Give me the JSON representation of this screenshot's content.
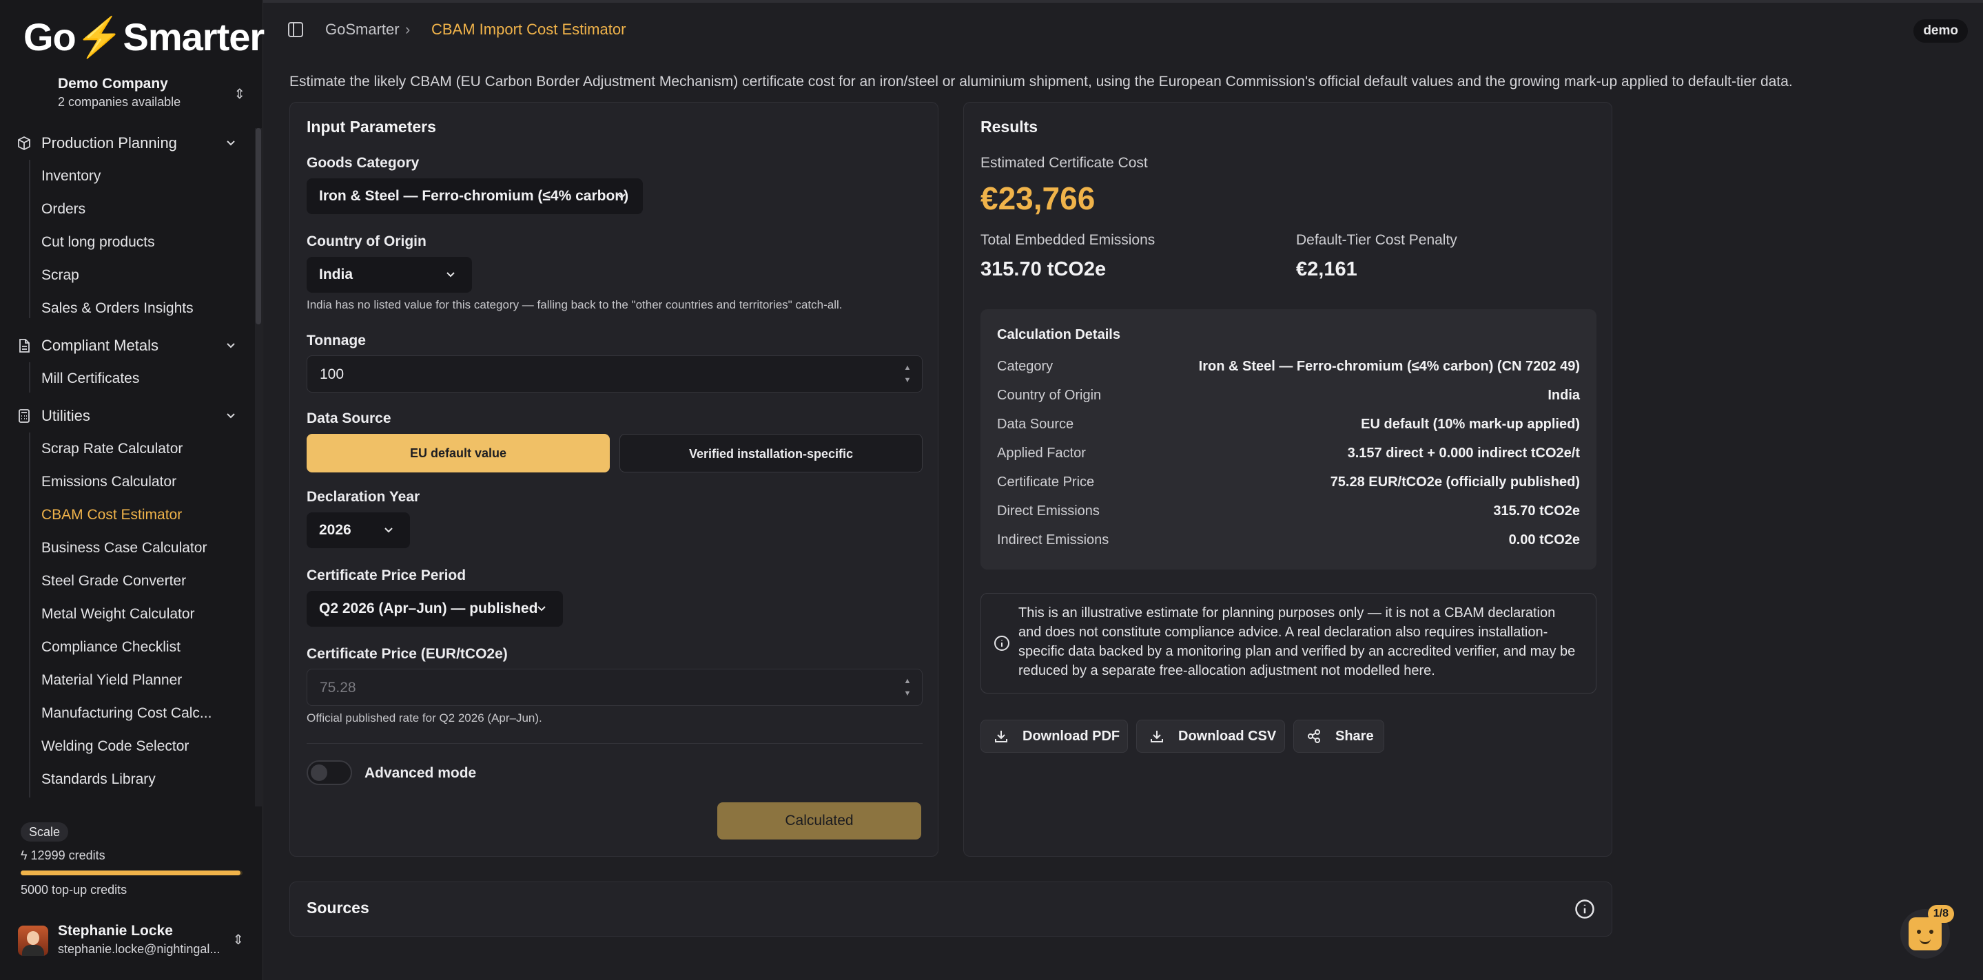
{
  "app": {
    "logo_text_1": "Go",
    "logo_bolt": "⚡",
    "logo_text_2": "Smarter"
  },
  "company": {
    "name": "Demo Company",
    "subtitle": "2 companies available"
  },
  "sidebar": {
    "groups": [
      {
        "label": "Production Planning",
        "icon": "cube-icon",
        "items": [
          "Inventory",
          "Orders",
          "Cut long products",
          "Scrap",
          "Sales & Orders Insights"
        ]
      },
      {
        "label": "Compliant Metals",
        "icon": "document-icon",
        "items": [
          "Mill Certificates"
        ]
      },
      {
        "label": "Utilities",
        "icon": "calculator-icon",
        "items": [
          "Scrap Rate Calculator",
          "Emissions Calculator",
          "CBAM Cost Estimator",
          "Business Case Calculator",
          "Steel Grade Converter",
          "Metal Weight Calculator",
          "Compliance Checklist",
          "Material Yield Planner",
          "Manufacturing Cost Calc...",
          "Welding Code Selector",
          "Standards Library"
        ]
      }
    ],
    "active_item": "CBAM Cost Estimator",
    "plan": "Scale",
    "credits": "12999 credits",
    "credits_fraction": 0.99,
    "topup": "5000 top-up credits",
    "user": {
      "name": "Stephanie Locke",
      "email": "stephanie.locke@nightingal..."
    }
  },
  "header": {
    "breadcrumb_root": "GoSmarter",
    "breadcrumb_current": "CBAM Import Cost Estimator",
    "badge": "demo"
  },
  "intro": "Estimate the likely CBAM (EU Carbon Border Adjustment Mechanism) certificate cost for an iron/steel or aluminium shipment, using the European Commission's official default values and the growing mark-up applied to default-tier data.",
  "inputs": {
    "title": "Input Parameters",
    "goods_category_label": "Goods Category",
    "goods_category_value": "Iron & Steel — Ferro-chromium (≤4% carbon)",
    "country_label": "Country of Origin",
    "country_value": "India",
    "country_hint": "India has no listed value for this category — falling back to the \"other countries and territories\" catch-all.",
    "tonnage_label": "Tonnage",
    "tonnage_value": "100",
    "data_source_label": "Data Source",
    "data_source_options": [
      "EU default value",
      "Verified installation-specific"
    ],
    "data_source_selected": "EU default value",
    "year_label": "Declaration Year",
    "year_value": "2026",
    "price_period_label": "Certificate Price Period",
    "price_period_value": "Q2 2026 (Apr–Jun) — published",
    "price_label": "Certificate Price (EUR/tCO2e)",
    "price_placeholder": "75.28",
    "price_hint": "Official published rate for Q2 2026 (Apr–Jun).",
    "advanced_label": "Advanced mode",
    "advanced_on": false,
    "calc_button": "Calculated"
  },
  "results": {
    "title": "Results",
    "estimated_label": "Estimated Certificate Cost",
    "estimated_value": "€23,766",
    "emissions_label": "Total Embedded Emissions",
    "emissions_value": "315.70 tCO2e",
    "penalty_label": "Default-Tier Cost Penalty",
    "penalty_value": "€2,161",
    "details_title": "Calculation Details",
    "details": [
      {
        "k": "Category",
        "v": "Iron & Steel — Ferro-chromium (≤4% carbon) (CN 7202 49)"
      },
      {
        "k": "Country of Origin",
        "v": "India"
      },
      {
        "k": "Data Source",
        "v": "EU default (10% mark-up applied)"
      },
      {
        "k": "Applied Factor",
        "v": "3.157 direct + 0.000 indirect tCO2e/t"
      },
      {
        "k": "Certificate Price",
        "v": "75.28 EUR/tCO2e (officially published)"
      },
      {
        "k": "Direct Emissions",
        "v": "315.70 tCO2e"
      },
      {
        "k": "Indirect Emissions",
        "v": "0.00 tCO2e"
      }
    ],
    "disclaimer": "This is an illustrative estimate for planning purposes only — it is not a CBAM declaration and does not constitute compliance advice. A real declaration also requires installation-specific data backed by a monitoring plan and verified by an accredited verifier, and may be reduced by a separate free-allocation adjustment not modelled here.",
    "actions": [
      "Download PDF",
      "Download CSV",
      "Share"
    ]
  },
  "sources": {
    "title": "Sources"
  },
  "helper": {
    "count": "1/8"
  },
  "colors": {
    "accent": "#f0b34a",
    "background": "#1f1f23",
    "sidebar": "#18181b",
    "card": "#232328"
  }
}
